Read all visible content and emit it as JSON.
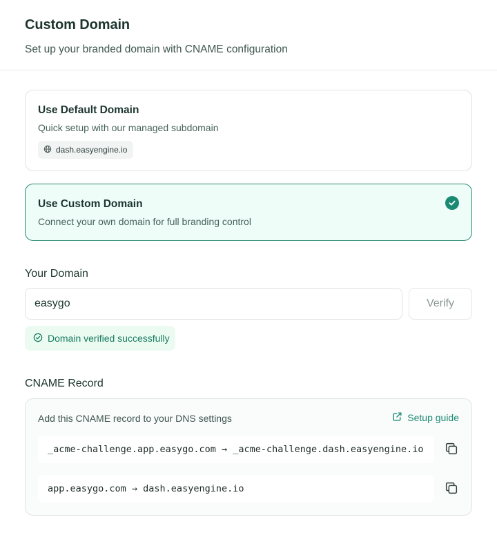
{
  "header": {
    "title": "Custom Domain",
    "subtitle": "Set up your branded domain with CNAME configuration"
  },
  "options": {
    "default": {
      "title": "Use Default Domain",
      "description": "Quick setup with our managed subdomain",
      "domain": "dash.easyengine.io",
      "selected": false
    },
    "custom": {
      "title": "Use Custom Domain",
      "description": "Connect your own domain for full branding control",
      "selected": true
    }
  },
  "your_domain": {
    "label": "Your Domain",
    "value": "easygo",
    "verify_label": "Verify",
    "status": "Domain verified successfully"
  },
  "cname": {
    "label": "CNAME Record",
    "instruction": "Add this CNAME record to your DNS settings",
    "guide_label": "Setup guide",
    "records": [
      "_acme-challenge.app.easygo.com → _acme-challenge.dash.easyengine.io",
      "app.easygo.com → dash.easyengine.io"
    ]
  },
  "colors": {
    "accent": "#1b8a73",
    "selected_bg": "#effdf9",
    "success_bg": "#ebfbf2",
    "success_text": "#177a5e"
  },
  "icons": [
    "globe-icon",
    "check-circle-icon",
    "success-check-icon",
    "external-link-icon",
    "copy-icon"
  ]
}
